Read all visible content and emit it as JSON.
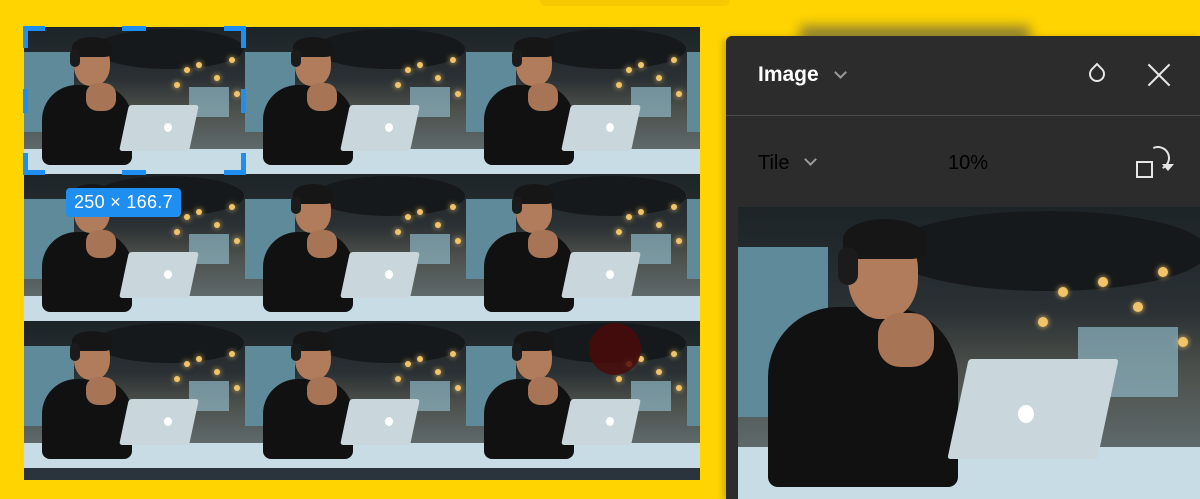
{
  "selection": {
    "size_label": "250 × 166.7"
  },
  "panel": {
    "title": "Image",
    "mode": "Tile",
    "scale": "10%",
    "icons": {
      "title_chevron": "chevron-down-icon",
      "mode_chevron": "chevron-down-icon",
      "filter": "drop-icon",
      "close": "close-icon",
      "rotate": "rotate-icon"
    }
  },
  "colors": {
    "background": "#FFD400",
    "panel": "#2c2c2c",
    "selection": "#1e8ef0"
  }
}
